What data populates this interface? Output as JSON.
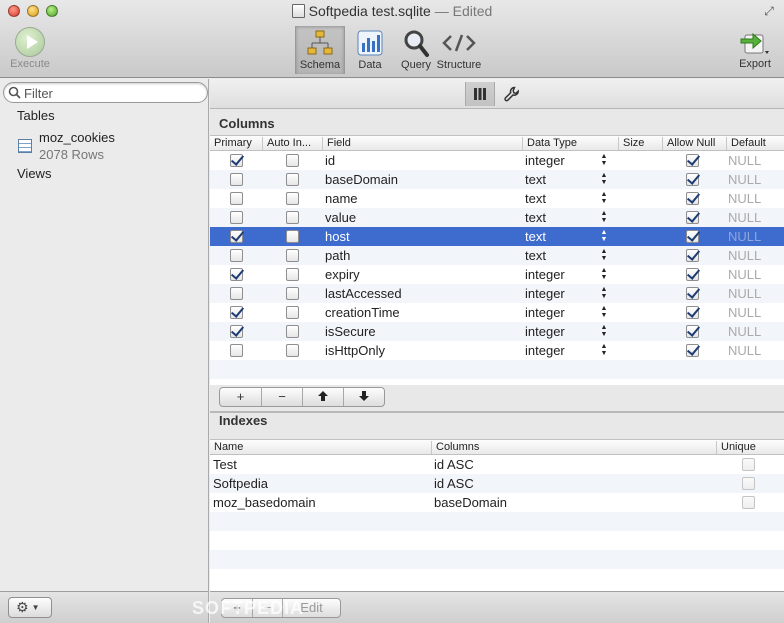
{
  "window": {
    "title": "Softpedia test.sqlite",
    "status": "— Edited"
  },
  "toolbar": {
    "execute_label": "Execute",
    "segments": [
      {
        "label": "Schema",
        "active": true
      },
      {
        "label": "Data",
        "active": false
      },
      {
        "label": "Query",
        "active": false
      },
      {
        "label": "Structure",
        "active": false
      }
    ],
    "export_label": "Export"
  },
  "sidebar": {
    "filter_placeholder": "Filter",
    "tables_header": "Tables",
    "table": {
      "name": "moz_cookies",
      "rows": "2078 Rows"
    },
    "views_header": "Views"
  },
  "columns_section": {
    "title": "Columns",
    "headers": [
      "Primary",
      "Auto In...",
      "Field",
      "Data Type",
      "Size",
      "Allow Null",
      "Default"
    ],
    "rows": [
      {
        "primary": true,
        "auto": false,
        "field": "id",
        "type": "integer",
        "size": "",
        "allow_null": true,
        "default": "NULL"
      },
      {
        "primary": false,
        "auto": false,
        "field": "baseDomain",
        "type": "text",
        "size": "",
        "allow_null": true,
        "default": "NULL"
      },
      {
        "primary": false,
        "auto": false,
        "field": "name",
        "type": "text",
        "size": "",
        "allow_null": true,
        "default": "NULL"
      },
      {
        "primary": false,
        "auto": false,
        "field": "value",
        "type": "text",
        "size": "",
        "allow_null": true,
        "default": "NULL"
      },
      {
        "primary": true,
        "auto": false,
        "field": "host",
        "type": "text",
        "size": "",
        "allow_null": true,
        "default": "NULL",
        "selected": true
      },
      {
        "primary": false,
        "auto": false,
        "field": "path",
        "type": "text",
        "size": "",
        "allow_null": true,
        "default": "NULL"
      },
      {
        "primary": true,
        "auto": false,
        "field": "expiry",
        "type": "integer",
        "size": "",
        "allow_null": true,
        "default": "NULL"
      },
      {
        "primary": false,
        "auto": false,
        "field": "lastAccessed",
        "type": "integer",
        "size": "",
        "allow_null": true,
        "default": "NULL"
      },
      {
        "primary": true,
        "auto": false,
        "field": "creationTime",
        "type": "integer",
        "size": "",
        "allow_null": true,
        "default": "NULL"
      },
      {
        "primary": true,
        "auto": false,
        "field": "isSecure",
        "type": "integer",
        "size": "",
        "allow_null": true,
        "default": "NULL"
      },
      {
        "primary": false,
        "auto": false,
        "field": "isHttpOnly",
        "type": "integer",
        "size": "",
        "allow_null": true,
        "default": "NULL"
      }
    ],
    "buttons": {
      "add": "+",
      "remove": "−",
      "up": "🡡",
      "down": "🡣"
    }
  },
  "indexes_section": {
    "title": "Indexes",
    "headers": [
      "Name",
      "Columns",
      "Unique"
    ],
    "rows": [
      {
        "name": "Test",
        "columns": "id ASC",
        "unique": false
      },
      {
        "name": "Softpedia",
        "columns": "id ASC",
        "unique": false
      },
      {
        "name": "moz_basedomain",
        "columns": "baseDomain",
        "unique": false
      }
    ]
  },
  "bottom": {
    "gear": "⚙",
    "add": "+",
    "remove": "−",
    "edit": "Edit",
    "watermark": "SOFTPEDIA"
  },
  "colors": {
    "selection": "#3d6bce",
    "stripe": "#f2f5fa",
    "check": "#1d3c73"
  }
}
